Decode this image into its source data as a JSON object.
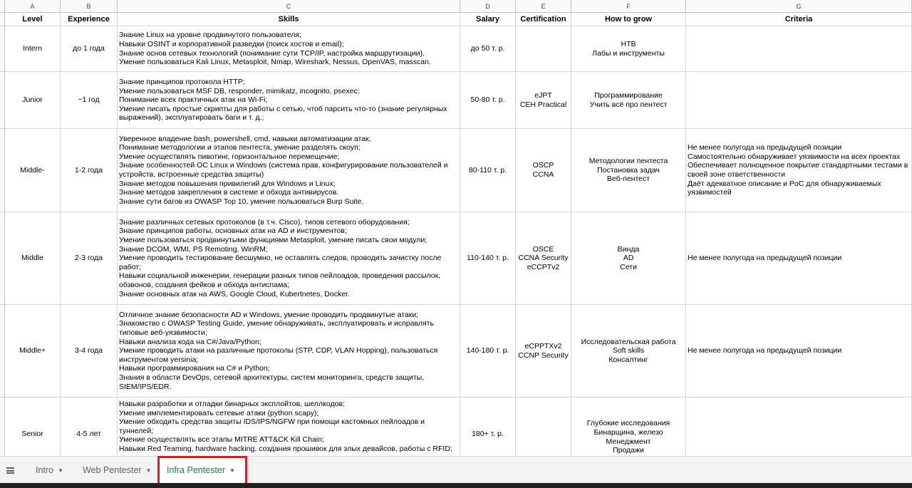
{
  "columns": [
    "A",
    "B",
    "C",
    "D",
    "E",
    "F",
    "G"
  ],
  "headers": {
    "level": "Level",
    "experience": "Experience",
    "skills": "Skills",
    "salary": "Salary",
    "certification": "Certification",
    "how_to_grow": "How to grow",
    "criteria": "Criteria"
  },
  "rows": [
    {
      "level": "Intern",
      "experience": "до 1 года",
      "skills": "Знание Linux на уровне продвинутого пользователя;\nНавыки OSINT и корпоративной разведки (поиск хостов и email);\nЗнание основ сетевых технологий (понимание сути TCP/IP, настройка маршрутизации).\nУмение пользоваться Kali Linux, Metasploit, Nmap, Wireshark, Nessus, OpenVAS, masscan.",
      "salary": "до 50 т. р.",
      "certification": "",
      "how_to_grow": "HTB\nЛабы и инструменты",
      "criteria": ""
    },
    {
      "level": "Junior",
      "experience": "~1 год",
      "skills": "Знание принципов протокола HTTP;\nУмение пользоваться MSF DB, responder, mimikatz, incognito, psexec;\nПонимание всех практичных атак на Wi-Fi;\nУмение писать простые скрипты для работы с сетью, чтоб парсить что-то (знание регулярных\nвыражений), эксплуатировать баги и т. д.;",
      "salary": "50-80 т. р.",
      "certification": "eJPT\nCEH Practical",
      "how_to_grow": "Программирование\nУчить всё про пентест",
      "criteria": ""
    },
    {
      "level": "Middle-",
      "experience": "1-2 года",
      "skills": "Уверенное владение bash, powershell, cmd, навыки автоматизации атак;\nПонимание методологии и этапов пентеста, умение разделять скоуп;\nУмение осуществлять пивотинг, горизонтальное перемещение;\nЗнание особенностей ОС Linux и Windows (система прав, конфигурирование пользователей и\nустройств, встроенные средства защиты)\nЗнание методов повышения привилегий для Windows и Linux;\nЗнание методов закрепления в системе и обхода антивирусов.\nЗнание сути багов из OWASP Top 10, умение пользоваться Burp Suite.",
      "salary": "80-110 т. р.",
      "certification": "OSCP\nCCNA",
      "how_to_grow": "Методологии пентеста\nПостановка задач\nВеб-пентест",
      "criteria": "Не менее полугода на предыдущей позиции\nСамостоятельно обнаруживает уязвимости на всех проектах\nОбеспечивает полноценное покрытие стандартными тестами в\nсвоей зоне ответственности\nДаёт адекватное описание и PoC для обнаруживаемых\nуязвимостей"
    },
    {
      "level": "Middle",
      "experience": "2-3 года",
      "skills": "Знание различных сетевых протоколов (в т.ч. Cisco), типов сетевого оборудования;\nЗнание принципов работы, основных атак на AD и инструментов;\nУмение пользоваться продвинутыми функциями Metasploit, умение писать свои модули;\nЗнание DCOM, WMI, PS Remoting, WinRM;\nУмение проводить тестирование бесшумно, не оставлять следов, проводить зачистку после\nработ;\nНавыки социальной инженерии, генерации разных типов пейлоадов, проведения рассылок,\nобзвонов, создания фейков и обхода антиспама;\nЗнание основных атак на AWS, Google Cloud, Kubertnetes, Docker.",
      "salary": "110-140 т. р.",
      "certification": "OSCE\nCCNA Security\neCCPTv2",
      "how_to_grow": "Винда\nAD\nСети",
      "criteria": "Не менее полугода на предыдущей позиции"
    },
    {
      "level": "Middle+",
      "experience": "3-4 года",
      "skills": "Отличное знание безопасности AD и Windows, умение проводить продвинутые атаки;\nЗнакомство с OWASP Testing Guide, умение обнаруживать, эксплуатировать и исправлять\nтиповые веб-уязвимости;\nНавыки анализа кода на C#/Java/Python;\nУмение проводить атаки на различные протоколы (STP, CDP, VLAN Hopping), пользоваться\nинструментом yersinia;\nНавыки программирования на C# и Python;\nЗнания в области DevOps, сетевой архитектуры, систем мониторинга, средств защиты,\nSIEM/IPS/EDR.",
      "salary": "140-180 т. р.",
      "certification": "eCPPTXv2\nCCNP Security",
      "how_to_grow": "Исследовательская работа\nSoft skills\nКонсалтинг",
      "criteria": "Не менее полугода на предыдущей позиции"
    },
    {
      "level": "Senior",
      "experience": "4-5 лет",
      "skills": "Навыки разработки и отладки бинарных эксплойтов, шеллкодов;\nУмение имплементировать сетевые атаки (python scapy);\nУмение обходить средства защиты IDS/IPS/NGFW при помощи кастомных пейлоадов и\nтуннелей;\nУмение осуществлять все этапы MITRE ATT&CK Kill Chain;\nНавыки Red Teaming, hardware hacking, создания прошивок для злых девайсов, работы с RFID;",
      "salary": "180+ т. р.",
      "certification": "",
      "how_to_grow": "Глубокие исследования\nБинарщина, железо\nМенеджмент\nПродажи",
      "criteria": ""
    }
  ],
  "tabs": [
    {
      "label": "Intro"
    },
    {
      "label": "Web Pentester"
    },
    {
      "label": "Infra Pentester"
    }
  ],
  "colors": {
    "active_tab": "#188038",
    "highlight": "#e01b1b",
    "grid": "#d4d4d4"
  },
  "icons": {
    "all_sheets": "menu-icon",
    "tab_dropdown": "triangle-down-icon"
  }
}
